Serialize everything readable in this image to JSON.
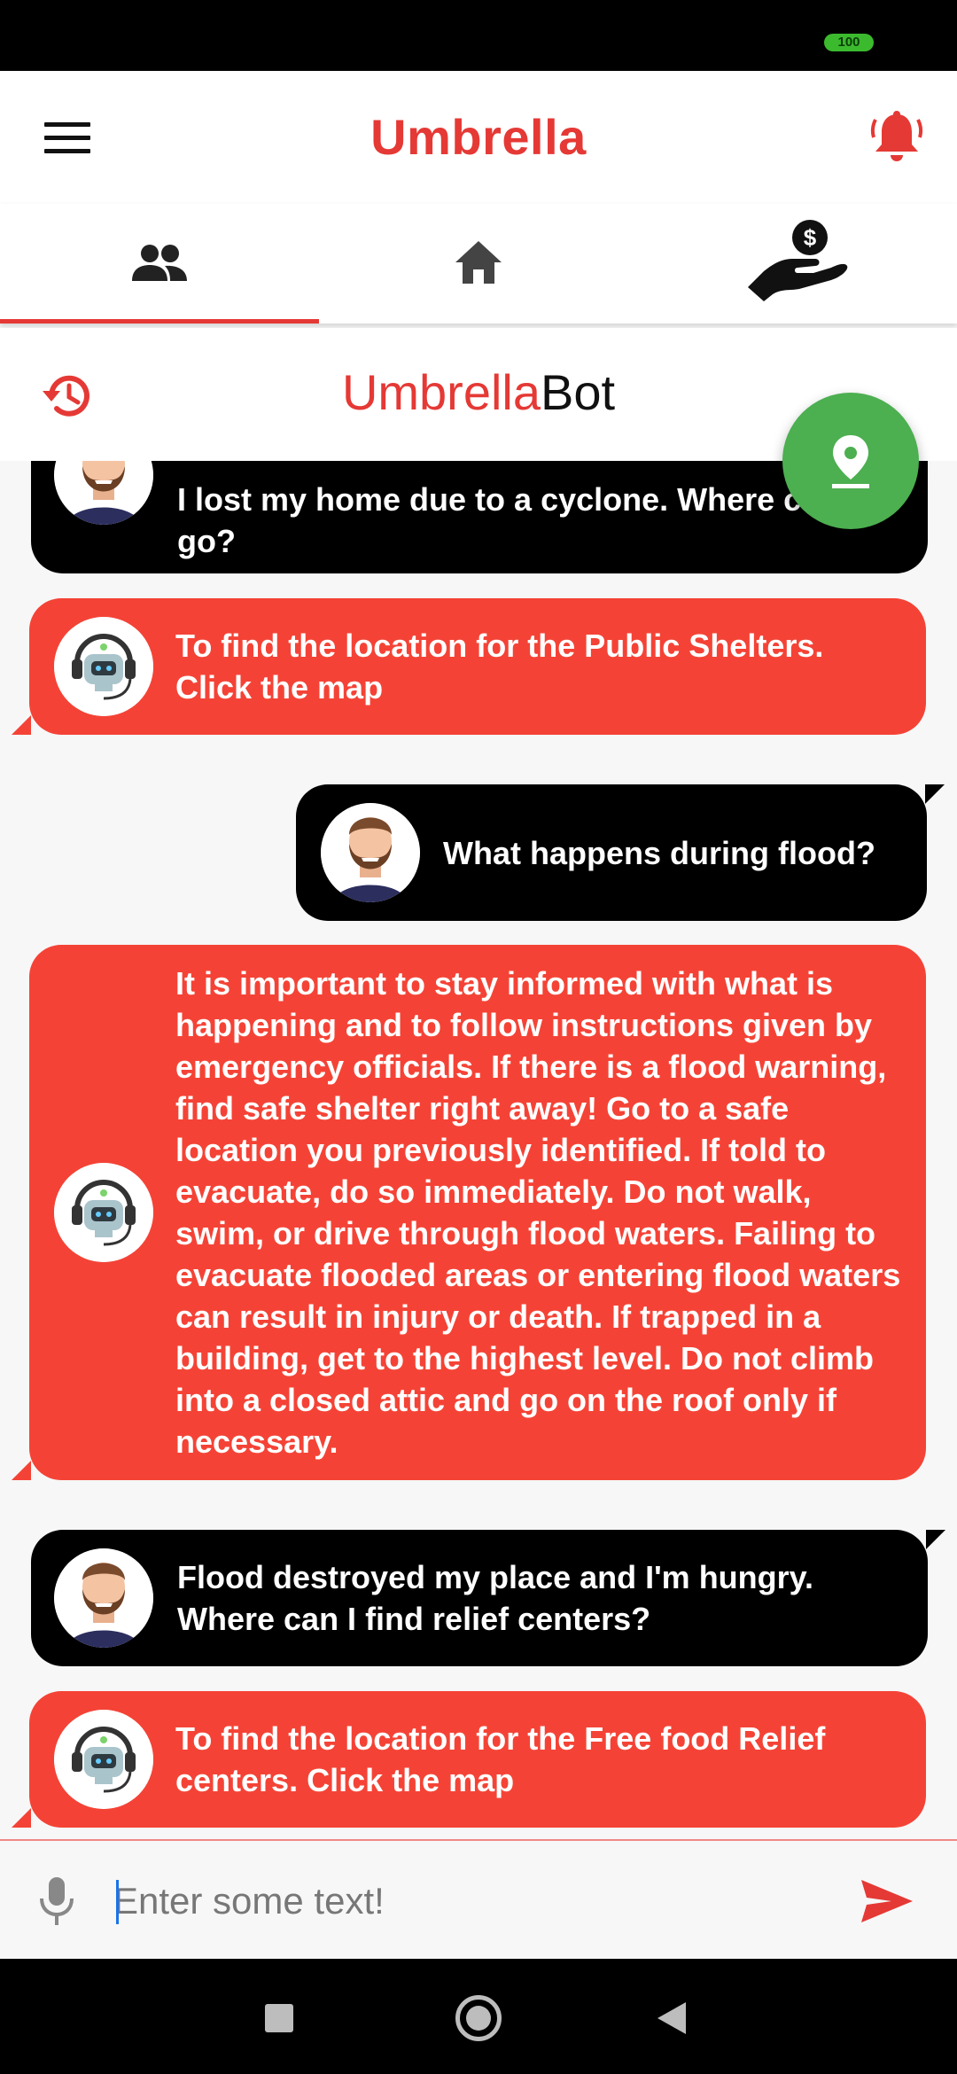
{
  "status_bar": {
    "battery": "100"
  },
  "app_bar": {
    "title": "Umbrella"
  },
  "tabs": [
    {
      "icon": "people-icon",
      "active": true
    },
    {
      "icon": "home-icon",
      "active": false
    },
    {
      "icon": "donate-hand-icon",
      "active": false
    }
  ],
  "bot_header": {
    "title_part1": "Umbrella",
    "title_part2": "Bot"
  },
  "messages": [
    {
      "sender": "user",
      "text": "I lost my home due to a cyclone. Where can I go?"
    },
    {
      "sender": "bot",
      "text": "To find the location for the Public Shelters. Click the map"
    },
    {
      "sender": "user",
      "text": "What happens during flood?"
    },
    {
      "sender": "bot",
      "text": "It is important to stay informed with what is happening and to follow instructions given by emergency officials. If there is a flood warning, find safe shelter right away! Go to a safe location you previously identified. If told to evacuate, do so immediately. Do not walk, swim, or drive through flood waters. Failing to evacuate flooded areas or entering flood waters can result in injury or death. If trapped in a building, get to the highest level. Do not climb into a closed attic and go on the roof only if necessary."
    },
    {
      "sender": "user",
      "text": "Flood destroyed my place and I'm hungry. Where can I find relief centers?"
    },
    {
      "sender": "bot",
      "text": "To find the location for the Free food Relief centers. Click the map"
    }
  ],
  "input": {
    "placeholder": "Enter some text!",
    "value": ""
  },
  "colors": {
    "accent": "#e53935",
    "bot_bubble": "#f44336",
    "user_bubble": "#000000",
    "fab": "#4caf50"
  }
}
